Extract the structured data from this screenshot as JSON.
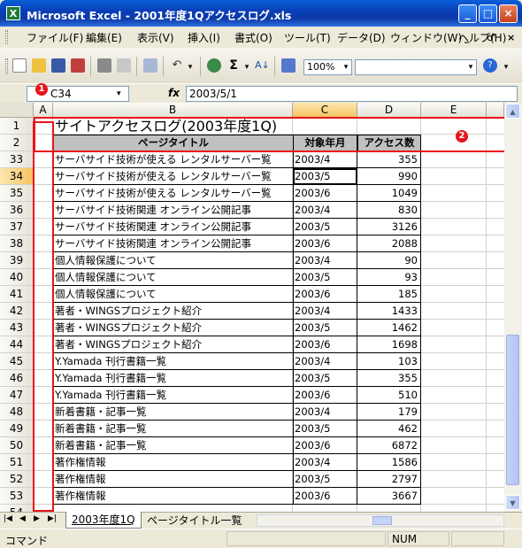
{
  "window": {
    "title": "Microsoft Excel - 2001年度1Qアクセスログ.xls",
    "app_icon_label": "X",
    "min_label": "_",
    "max_label": "□",
    "close_label": "×"
  },
  "menu": {
    "items": [
      "ファイル(F)",
      "編集(E)",
      "表示(V)",
      "挿入(I)",
      "書式(O)",
      "ツール(T)",
      "データ(D)",
      "ウィンドウ(W)",
      "ヘルプ(H)"
    ],
    "doc_controls": [
      "_",
      "♂",
      "×"
    ]
  },
  "toolbar": {
    "zoom": "100%",
    "icons": [
      "new-icon",
      "open-icon",
      "save-icon",
      "permission-icon",
      "print-icon",
      "print-preview-icon",
      "copy-icon",
      "undo-icon",
      "hyperlink-icon",
      "autosum-icon",
      "sort-ascending-icon",
      "chart-wizard-icon",
      "help-icon"
    ],
    "sum_symbol": "Σ"
  },
  "formula_bar": {
    "name_box": "C34",
    "fx_label": "fx",
    "value": "2003/5/1"
  },
  "columns": [
    "A",
    "B",
    "C",
    "D",
    "E"
  ],
  "sheet": {
    "title": "サイトアクセスログ(2003年度1Q)",
    "header": [
      "ページタイトル",
      "対象年月",
      "アクセス数"
    ],
    "rows": [
      {
        "n": "33",
        "title": "サーバサイド技術が使える レンタルサーバー覧",
        "ym": "2003/4",
        "count": "355"
      },
      {
        "n": "34",
        "title": "サーバサイド技術が使える レンタルサーバー覧",
        "ym": "2003/5",
        "count": "990"
      },
      {
        "n": "35",
        "title": "サーバサイド技術が使える レンタルサーバー覧",
        "ym": "2003/6",
        "count": "1049"
      },
      {
        "n": "36",
        "title": "サーバサイド技術関連 オンライン公開記事",
        "ym": "2003/4",
        "count": "830"
      },
      {
        "n": "37",
        "title": "サーバサイド技術関連 オンライン公開記事",
        "ym": "2003/5",
        "count": "3126"
      },
      {
        "n": "38",
        "title": "サーバサイド技術関連 オンライン公開記事",
        "ym": "2003/6",
        "count": "2088"
      },
      {
        "n": "39",
        "title": "個人情報保護について",
        "ym": "2003/4",
        "count": "90"
      },
      {
        "n": "40",
        "title": "個人情報保護について",
        "ym": "2003/5",
        "count": "93"
      },
      {
        "n": "41",
        "title": "個人情報保護について",
        "ym": "2003/6",
        "count": "185"
      },
      {
        "n": "42",
        "title": "著者・WINGSプロジェクト紹介",
        "ym": "2003/4",
        "count": "1433"
      },
      {
        "n": "43",
        "title": "著者・WINGSプロジェクト紹介",
        "ym": "2003/5",
        "count": "1462"
      },
      {
        "n": "44",
        "title": "著者・WINGSプロジェクト紹介",
        "ym": "2003/6",
        "count": "1698"
      },
      {
        "n": "45",
        "title": "Y.Yamada 刊行書籍一覧",
        "ym": "2003/4",
        "count": "103"
      },
      {
        "n": "46",
        "title": "Y.Yamada 刊行書籍一覧",
        "ym": "2003/5",
        "count": "355"
      },
      {
        "n": "47",
        "title": "Y.Yamada 刊行書籍一覧",
        "ym": "2003/6",
        "count": "510"
      },
      {
        "n": "48",
        "title": "新着書籍・記事一覧",
        "ym": "2003/4",
        "count": "179"
      },
      {
        "n": "49",
        "title": "新着書籍・記事一覧",
        "ym": "2003/5",
        "count": "462"
      },
      {
        "n": "50",
        "title": "新着書籍・記事一覧",
        "ym": "2003/6",
        "count": "6872"
      },
      {
        "n": "51",
        "title": "著作権情報",
        "ym": "2003/4",
        "count": "1586"
      },
      {
        "n": "52",
        "title": "著作権情報",
        "ym": "2003/5",
        "count": "2797"
      },
      {
        "n": "53",
        "title": "著作権情報",
        "ym": "2003/6",
        "count": "3667"
      }
    ],
    "extra_rows": [
      "54"
    ]
  },
  "annotations": {
    "marker1": "1",
    "marker2": "2"
  },
  "tabs": [
    "2003年度1Q",
    "ページタイトル一覧"
  ],
  "status": {
    "left": "コマンド",
    "num": "NUM"
  },
  "colors": {
    "annotation_red": "#e8141c",
    "selected_header": "#f6c463",
    "title_blue": "#0a3fb8"
  }
}
